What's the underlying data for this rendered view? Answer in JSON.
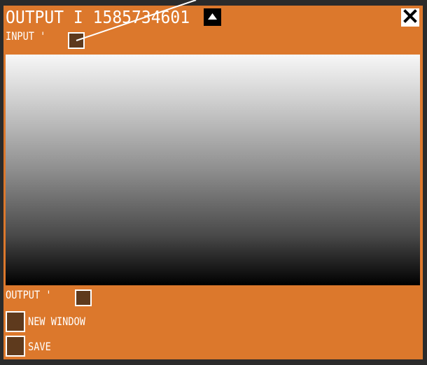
{
  "node": {
    "title": "OUTPUT I 1585734601",
    "collapse_icon": "chevron-up-icon",
    "close_icon": "close-icon",
    "input_label": "INPUT '",
    "output_label": "OUTPUT '",
    "new_window_label": "NEW WINDOW",
    "save_label": "SAVE"
  },
  "colors": {
    "node_background": "#dc782c",
    "port_fill": "#5e3a1d",
    "text": "#ffffff",
    "canvas_background": "#2b2b2b"
  }
}
